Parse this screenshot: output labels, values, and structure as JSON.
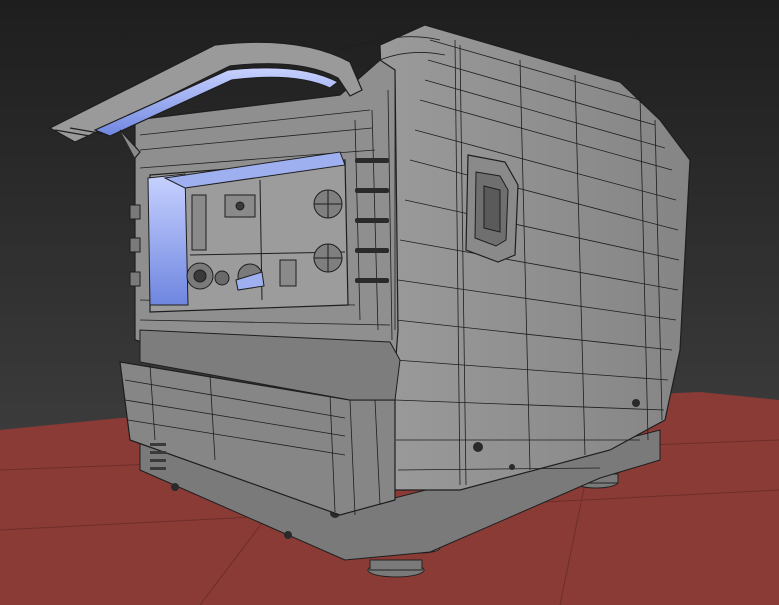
{
  "scene": {
    "background_top": "#1f1f1f",
    "background_bottom": "#4a4a4a",
    "floor_color": "#8a3b36",
    "body_color": "#8c8c8c",
    "body_shadow": "#6e6e6e",
    "wire_color": "#1e1e1e",
    "glow_color": "#8fa6ff",
    "handle_color": "#9a9a9a",
    "window_glow": "#c8d2ff"
  }
}
